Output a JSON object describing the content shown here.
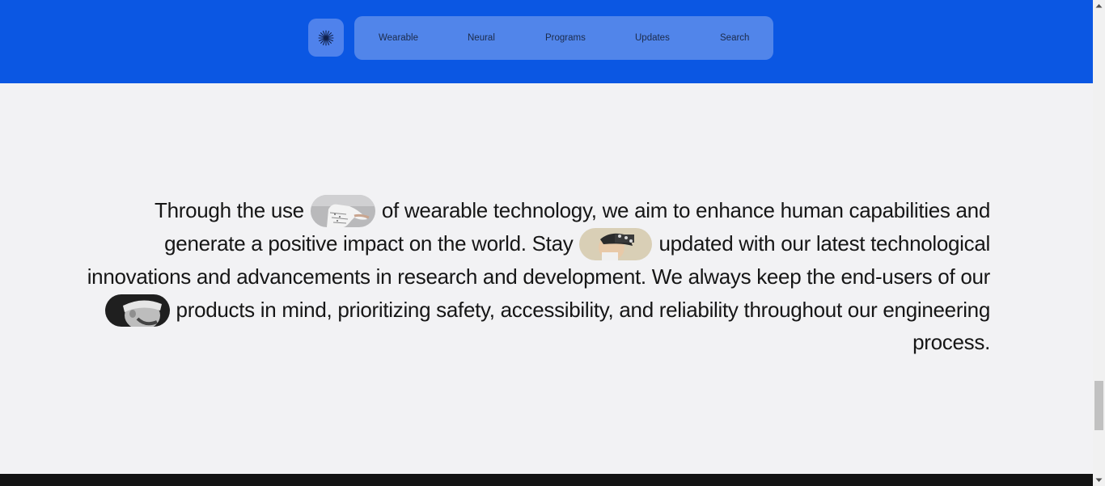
{
  "header": {
    "background": "#0b57e3",
    "logo_icon": "asterisk-burst-icon",
    "nav": [
      {
        "label": "Wearable"
      },
      {
        "label": "Neural"
      },
      {
        "label": "Programs"
      },
      {
        "label": "Updates"
      },
      {
        "label": "Search"
      }
    ]
  },
  "intro": {
    "line1_a": "Through the use",
    "line1_b": "of wearable technology, we aim to enhance human capabilities and",
    "line2_a": "generate a positive impact on the world. Stay",
    "line2_b": "updated with our latest technological",
    "line3": "innovations and advancements in research and development. We always keep the end-users of our",
    "line4": "products in mind, prioritizing safety, accessibility, and reliability throughout our engineering",
    "line5": "process.",
    "images": [
      "gloved-hand-image",
      "neural-headset-image",
      "headband-man-image"
    ]
  },
  "colors": {
    "accent": "#0b57e3",
    "page_bg": "#f2f2f4",
    "text": "#161616",
    "footer": "#131313"
  }
}
